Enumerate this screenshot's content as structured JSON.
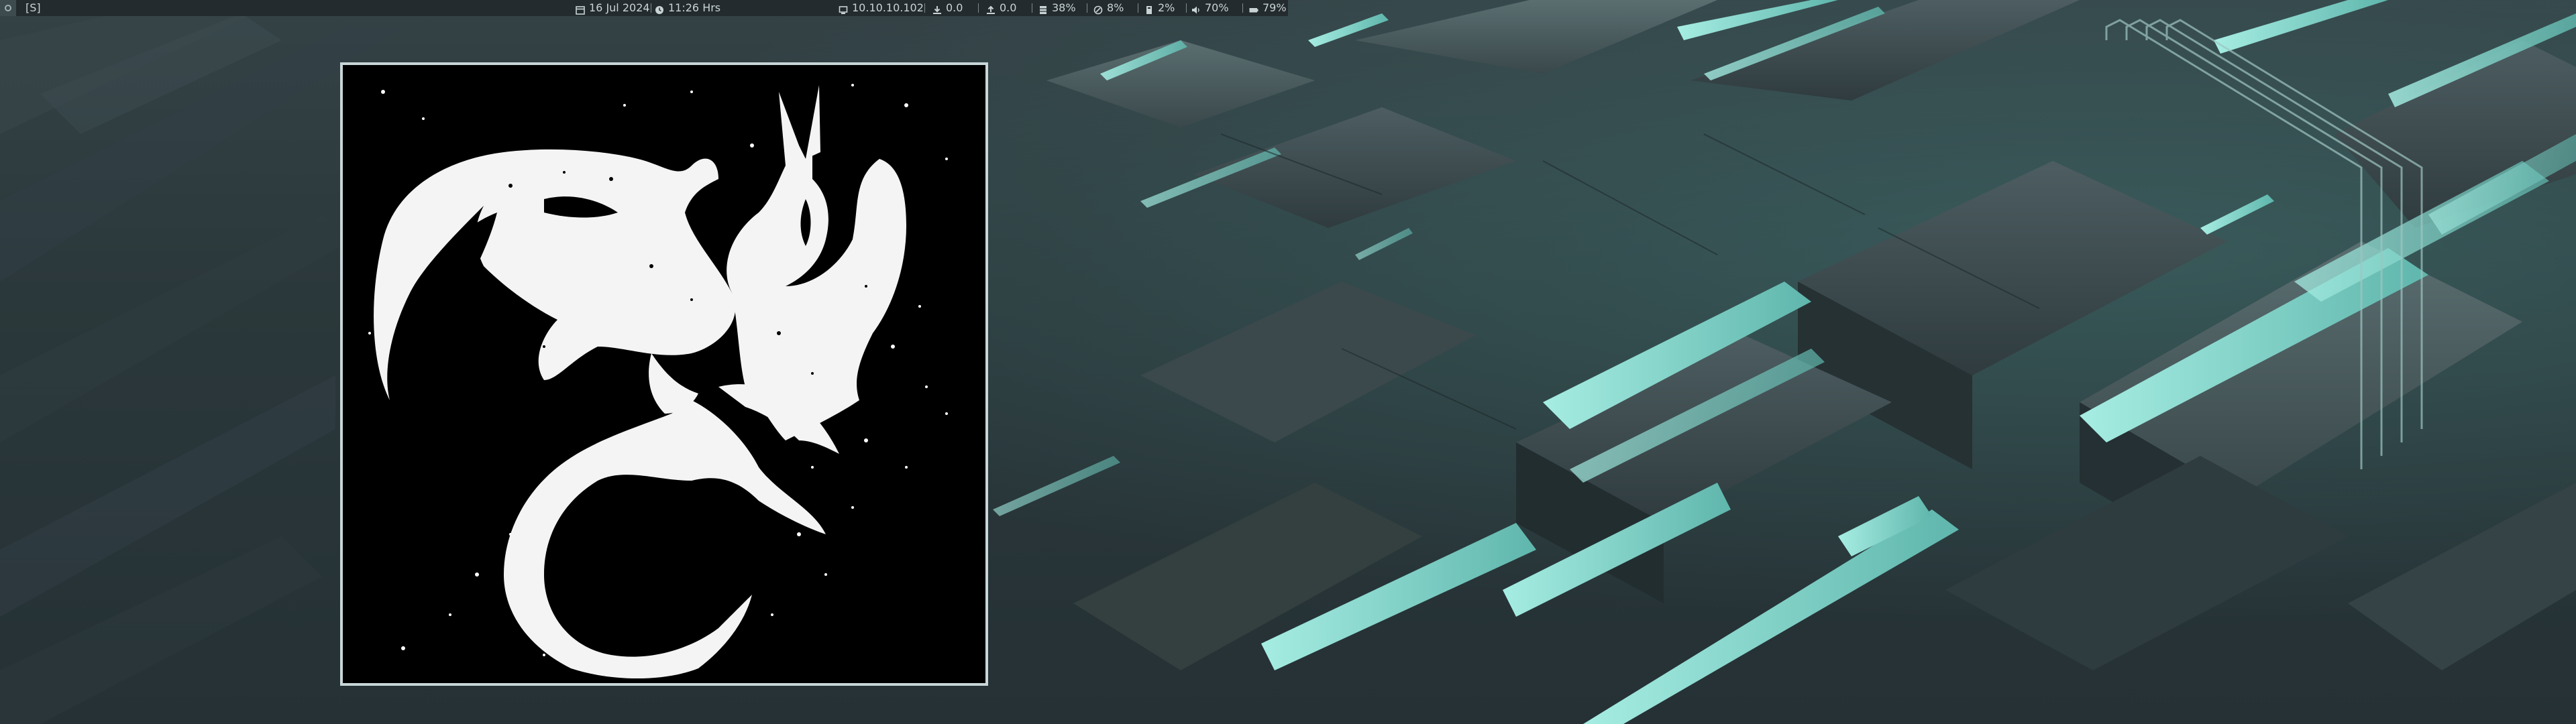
{
  "desktop": {
    "wallpaper": "abstract teal blocks",
    "accent_color": "#7fd3c8"
  },
  "topbar": {
    "workspace_icon": "circle-icon",
    "workspace_label": "[S]",
    "date_icon": "calendar-icon",
    "date": "16 Jul 2024",
    "time_icon": "clock-icon",
    "time": "11:26 Hrs",
    "network_icon": "network-icon",
    "ip": "10.10.10.102",
    "download_icon": "download-icon",
    "download": "0.0",
    "upload_icon": "upload-icon",
    "upload": "0.0",
    "memory_icon": "memory-icon",
    "memory": "38%",
    "cpu_icon": "cpu-icon",
    "cpu": "8%",
    "disk_icon": "disk-icon",
    "disk": "2%",
    "volume_icon": "volume-icon",
    "volume": "70%",
    "battery_icon": "battery-icon",
    "battery": "79%"
  },
  "image_window": {
    "content": "white dragon silhouette on black"
  }
}
